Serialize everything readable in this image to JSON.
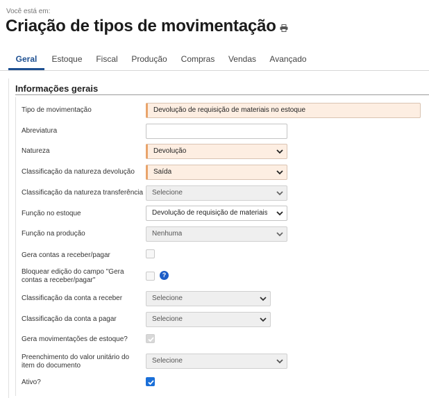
{
  "breadcrumb": "Você está em:",
  "page_title": "Criação de tipos de movimentação",
  "icons": {
    "print": "printer-icon",
    "help": "question-circle-icon",
    "chevron": "chevron-down-icon"
  },
  "tabs": [
    {
      "label": "Geral",
      "active": true
    },
    {
      "label": "Estoque"
    },
    {
      "label": "Fiscal"
    },
    {
      "label": "Produção"
    },
    {
      "label": "Compras"
    },
    {
      "label": "Vendas"
    },
    {
      "label": "Avançado"
    }
  ],
  "section": {
    "title": "Informações gerais",
    "fields": {
      "tipo_movimentacao": {
        "label": "Tipo de movimentação",
        "value": "Devolução de requisição de materiais no estoque"
      },
      "abreviatura": {
        "label": "Abreviatura",
        "value": ""
      },
      "natureza": {
        "label": "Natureza",
        "value": "Devolução"
      },
      "class_natureza_devolucao": {
        "label": "Classificação da natureza devolução",
        "value": "Saída"
      },
      "class_natureza_transferencia": {
        "label": "Classificação da natureza transferência",
        "value": "Selecione"
      },
      "funcao_estoque": {
        "label": "Função no estoque",
        "value": "Devolução de requisição de materiais ind"
      },
      "funcao_producao": {
        "label": "Função na produção",
        "value": "Nenhuma"
      },
      "gera_contas": {
        "label": "Gera contas a receber/pagar",
        "checked": false
      },
      "bloquear_edicao": {
        "label": "Bloquear edição do campo \"Gera contas a receber/pagar\"",
        "checked": false
      },
      "class_conta_receber": {
        "label": "Classificação da conta a receber",
        "value": "Selecione"
      },
      "class_conta_pagar": {
        "label": "Classificação da conta a pagar",
        "value": "Selecione"
      },
      "gera_movimentacoes": {
        "label": "Gera movimentações de estoque?",
        "checked": true
      },
      "preenchimento_valor": {
        "label": "Preenchimento do valor unitário do item do documento",
        "value": "Selecione"
      },
      "ativo": {
        "label": "Ativo?",
        "checked": true
      }
    }
  },
  "help_symbol": "?",
  "colors": {
    "accent": "#1d4f91",
    "highlight_bg": "#fdeee2",
    "checkbox_checked": "#1a6fd8"
  }
}
